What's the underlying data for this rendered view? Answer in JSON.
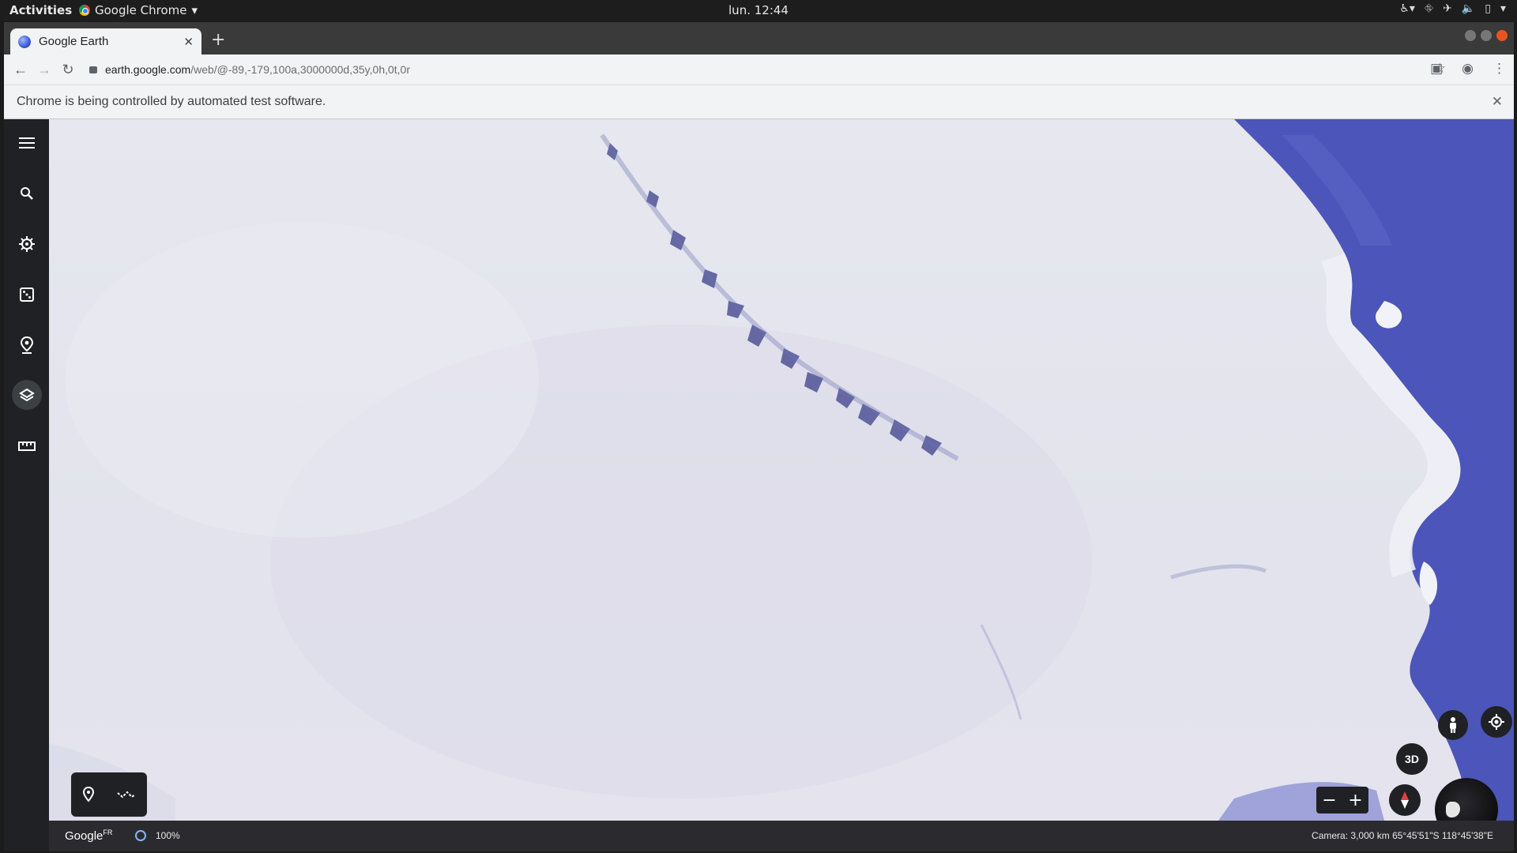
{
  "system_bar": {
    "activities": "Activities",
    "app_name": "Google Chrome",
    "clock": "lun. 12:44"
  },
  "browser": {
    "tab_title": "Google Earth",
    "url_domain": "earth.google.com",
    "url_path": "/web/@-89,-179,100a,3000000d,35y,0h,0t,0r",
    "infobar_message": "Chrome is being controlled by automated test software."
  },
  "earth": {
    "sidebar": {
      "items": [
        {
          "name": "menu-icon"
        },
        {
          "name": "search-icon"
        },
        {
          "name": "voyager-icon"
        },
        {
          "name": "feeling-lucky-icon"
        },
        {
          "name": "projects-icon"
        },
        {
          "name": "map-style-icon"
        },
        {
          "name": "measure-icon"
        }
      ]
    },
    "controls": {
      "three_d_label": "3D",
      "zoom_out": "−",
      "zoom_in": "+"
    },
    "status": {
      "google_logo": "Google",
      "country_code": "FR",
      "load_percent": "100%",
      "camera": "Camera: 3,000 km   65°45'51\"S 118°45'38\"E"
    },
    "colors": {
      "ice": "#e4e5ee",
      "ocean": "#4a55b8",
      "rail": "#202124"
    }
  }
}
